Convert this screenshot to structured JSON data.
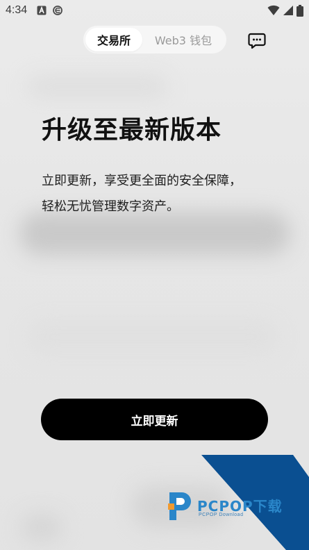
{
  "status_bar": {
    "time": "4:34"
  },
  "top_tabs": [
    {
      "label": "交易所",
      "active": true
    },
    {
      "label": "Web3 钱包",
      "active": false
    }
  ],
  "update": {
    "title": "升级至最新版本",
    "description_line1": "立即更新，享受更全面的安全保障，",
    "description_line2": "轻松无忧管理数字资产。",
    "button_label": "立即更新"
  },
  "watermark": {
    "brand": "PCPOP下载",
    "subtitle": "PCPOP Download"
  },
  "colors": {
    "button_bg": "#000000",
    "watermark_blue": "#0a4f91",
    "watermark_text": "#2a86c9"
  },
  "icons": [
    "a-font-icon",
    "browser-e-icon",
    "wifi-icon",
    "signal-icon",
    "battery-icon",
    "message-icon",
    "pcpop-logo-icon"
  ]
}
